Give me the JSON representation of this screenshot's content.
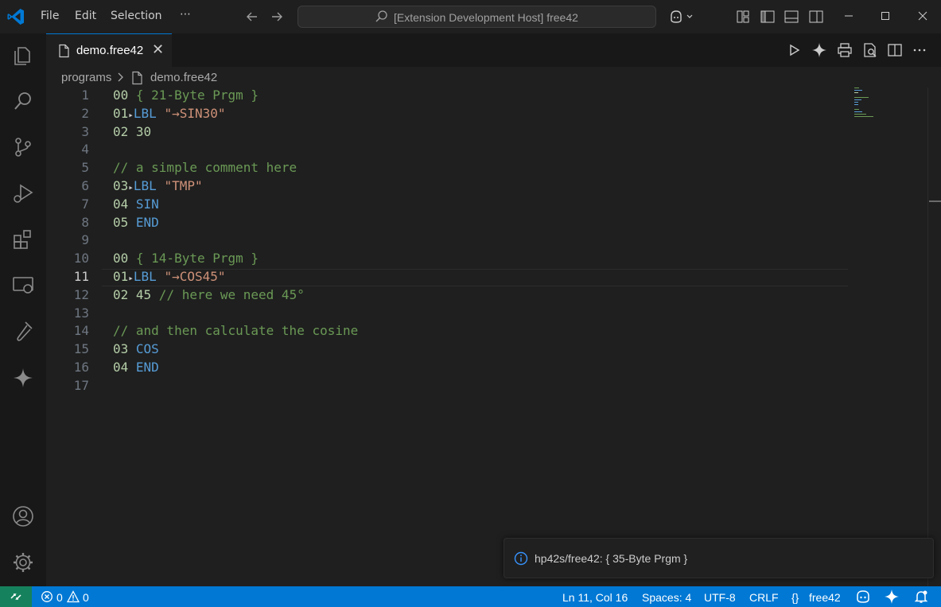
{
  "titlebar": {
    "menu": [
      "File",
      "Edit",
      "Selection"
    ],
    "more": "⋯",
    "command_center": "[Extension Development Host] free42"
  },
  "tab": {
    "label": "demo.free42",
    "close": "✕"
  },
  "breadcrumb": {
    "folder": "programs",
    "file": "demo.free42"
  },
  "editor": {
    "line_numbers": [
      "1",
      "2",
      "3",
      "4",
      "5",
      "6",
      "7",
      "8",
      "9",
      "10",
      "11",
      "12",
      "13",
      "14",
      "15",
      "16",
      "17"
    ],
    "current_line": 11,
    "lines": [
      [
        {
          "t": "00",
          "c": "num"
        },
        {
          "t": " { 21-Byte Prgm }",
          "c": "prg"
        }
      ],
      [
        {
          "t": "01",
          "c": "num"
        },
        {
          "t": "▸",
          "c": "arrow"
        },
        {
          "t": "LBL",
          "c": "cmd"
        },
        {
          "t": " ",
          "c": "plain"
        },
        {
          "t": "\"→SIN30\"",
          "c": "str"
        }
      ],
      [
        {
          "t": "02",
          "c": "num"
        },
        {
          "t": " ",
          "c": "plain"
        },
        {
          "t": "30",
          "c": "num"
        }
      ],
      [],
      [
        {
          "t": "// a simple comment here",
          "c": "cmt"
        }
      ],
      [
        {
          "t": "03",
          "c": "num"
        },
        {
          "t": "▸",
          "c": "arrow"
        },
        {
          "t": "LBL",
          "c": "cmd"
        },
        {
          "t": " ",
          "c": "plain"
        },
        {
          "t": "\"TMP\"",
          "c": "str"
        }
      ],
      [
        {
          "t": "04",
          "c": "num"
        },
        {
          "t": " ",
          "c": "plain"
        },
        {
          "t": "SIN",
          "c": "cmd"
        }
      ],
      [
        {
          "t": "05",
          "c": "num"
        },
        {
          "t": " ",
          "c": "plain"
        },
        {
          "t": "END",
          "c": "cmd"
        }
      ],
      [],
      [
        {
          "t": "00",
          "c": "num"
        },
        {
          "t": " { 14-Byte Prgm }",
          "c": "prg"
        }
      ],
      [
        {
          "t": "01",
          "c": "num"
        },
        {
          "t": "▸",
          "c": "arrow"
        },
        {
          "t": "LBL",
          "c": "cmd"
        },
        {
          "t": " ",
          "c": "plain"
        },
        {
          "t": "\"→COS45\"",
          "c": "str"
        }
      ],
      [
        {
          "t": "02",
          "c": "num"
        },
        {
          "t": " ",
          "c": "plain"
        },
        {
          "t": "45",
          "c": "num"
        },
        {
          "t": " // here we need 45°",
          "c": "cmt"
        }
      ],
      [],
      [
        {
          "t": "// and then calculate the cosine",
          "c": "cmt"
        }
      ],
      [
        {
          "t": "03",
          "c": "num"
        },
        {
          "t": " ",
          "c": "plain"
        },
        {
          "t": "COS",
          "c": "cmd"
        }
      ],
      [
        {
          "t": "04",
          "c": "num"
        },
        {
          "t": " ",
          "c": "plain"
        },
        {
          "t": "END",
          "c": "cmd"
        }
      ],
      []
    ]
  },
  "notification": {
    "message": "hp42s/free42: { 35-Byte Prgm }"
  },
  "statusbar": {
    "errors": "0",
    "warnings": "0",
    "position": "Ln 11, Col 16",
    "spaces": "Spaces: 4",
    "encoding": "UTF-8",
    "eol": "CRLF",
    "language": "free42",
    "language_icon": "{}"
  },
  "colors": {
    "accent": "#0078d4",
    "remote": "#16825d",
    "number": "#b5cea8",
    "command": "#569cd6",
    "string": "#ce9178",
    "comment": "#6a9955"
  }
}
